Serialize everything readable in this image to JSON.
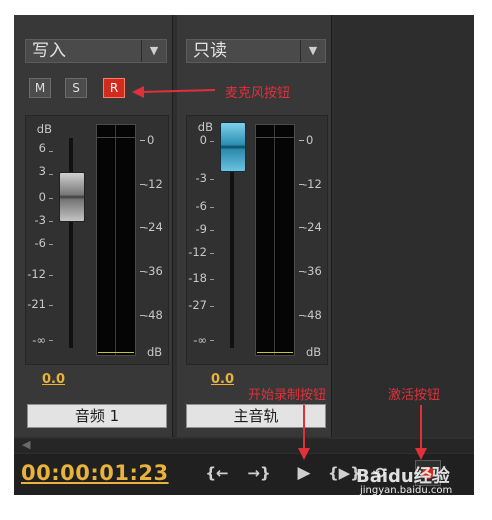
{
  "strip1": {
    "mode": "写入",
    "buttons": [
      "M",
      "S",
      "R"
    ],
    "db_label": "dB",
    "left_scale": [
      "6",
      "3",
      "0",
      "-3",
      "-6",
      "-12",
      "-21",
      "-∞"
    ],
    "right_scale": [
      "0",
      "-12",
      "-24",
      "-36",
      "-48",
      "dB"
    ],
    "gain": "0.0",
    "name": "音频 1"
  },
  "strip2": {
    "mode": "只读",
    "db_label": "dB",
    "left_scale": [
      "0",
      "-3",
      "-6",
      "-9",
      "-12",
      "-18",
      "-27",
      "-∞"
    ],
    "right_scale": [
      "0",
      "-12",
      "-24",
      "-36",
      "-48",
      "dB"
    ],
    "gain": "0.0",
    "name": "主音轨"
  },
  "transport": {
    "timecode": "00:00:01:23",
    "icons": [
      "step-back-icon",
      "step-forward-icon",
      "play-icon",
      "play-in-out-icon",
      "loop-icon",
      "record-icon"
    ]
  },
  "annotations": {
    "mic": "麦克风按钮",
    "start": "开始录制按钮",
    "activate": "激活按钮"
  },
  "watermark": {
    "brand": "Baidu经验",
    "url": "jingyan.baidu.com"
  },
  "colors": {
    "accent_red": "#d02b1c",
    "timecode_yellow": "#e8b23c",
    "annotation_red": "#e0303a"
  }
}
